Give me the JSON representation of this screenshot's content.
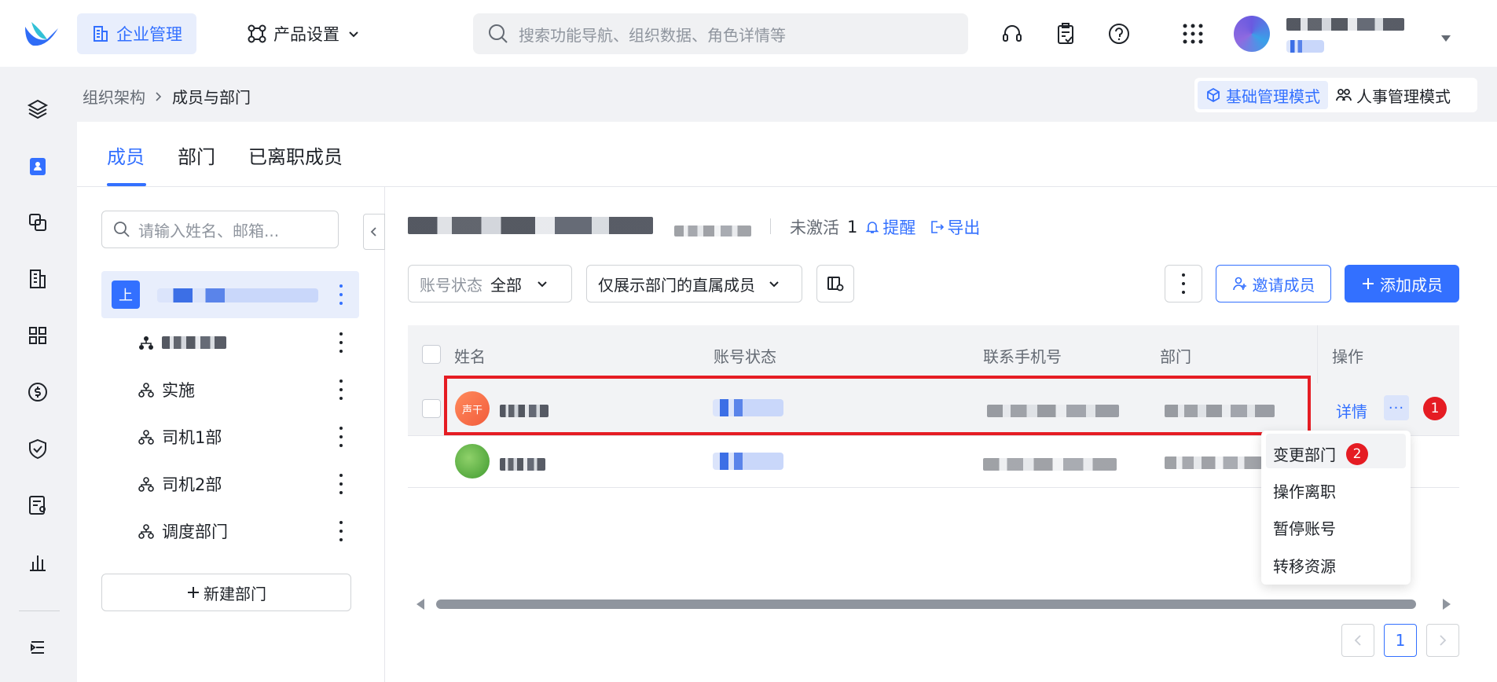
{
  "header": {
    "nav_enterprise": "企业管理",
    "nav_product": "产品设置",
    "search_placeholder": "搜索功能导航、组织数据、角色详情等"
  },
  "breadcrumb": {
    "root": "组织架构",
    "current": "成员与部门"
  },
  "modes": {
    "basic": "基础管理模式",
    "hr": "人事管理模式"
  },
  "tabs": [
    "成员",
    "部门",
    "已离职成员"
  ],
  "dept_panel": {
    "search_placeholder": "请输入姓名、邮箱...",
    "root_badge": "上",
    "items": [
      "实施",
      "司机1部",
      "司机2部",
      "调度部门"
    ],
    "new_dept": "新建部门"
  },
  "member_area": {
    "inactive_label": "未激活",
    "inactive_count": "1",
    "remind": "提醒",
    "export": "导出",
    "status_filter_label": "账号状态",
    "status_filter_value": "全部",
    "scope_filter": "仅展示部门的直属成员",
    "invite": "邀请成员",
    "add": "添加成员"
  },
  "table": {
    "columns": [
      "姓名",
      "账号状态",
      "联系手机号",
      "部门",
      "操作"
    ],
    "row1_avatar": "声干",
    "detail_link": "详情",
    "more": "···"
  },
  "menu_items": [
    "变更部门",
    "操作离职",
    "暂停账号",
    "转移资源"
  ],
  "annotations": [
    "1",
    "2"
  ],
  "pagination": {
    "current": "1"
  },
  "colors": {
    "accent": "#3370ff",
    "annotation": "#e51c23"
  }
}
